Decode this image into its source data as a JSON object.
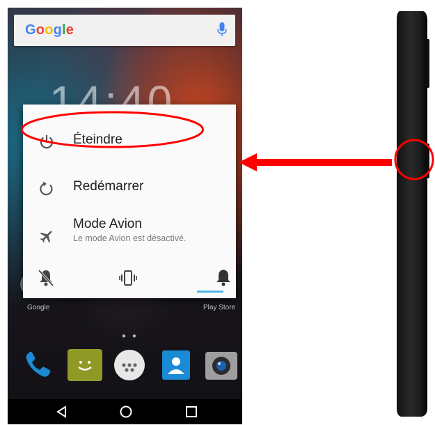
{
  "search": {
    "logo": "Google",
    "mic_icon": "microphone-icon"
  },
  "clock": {
    "time": "14:40"
  },
  "power_menu": {
    "items": [
      {
        "label": "Éteindre",
        "icon": "power-icon"
      },
      {
        "label": "Redémarrer",
        "icon": "restart-icon"
      },
      {
        "label": "Mode Avion",
        "sublabel": "Le mode Avion est désactivé.",
        "icon": "airplane-icon"
      }
    ],
    "sound_modes": [
      {
        "name": "silent",
        "icon": "bell-off-icon",
        "selected": false
      },
      {
        "name": "vibrate",
        "icon": "vibrate-icon",
        "selected": false
      },
      {
        "name": "sound",
        "icon": "bell-icon",
        "selected": true
      }
    ]
  },
  "home_labels": {
    "left": "Google",
    "right": "Play Store"
  },
  "colors": {
    "annotation_red": "#ff0000",
    "accent_blue": "#4fb5e6",
    "dialog_bg": "#fafafa"
  }
}
